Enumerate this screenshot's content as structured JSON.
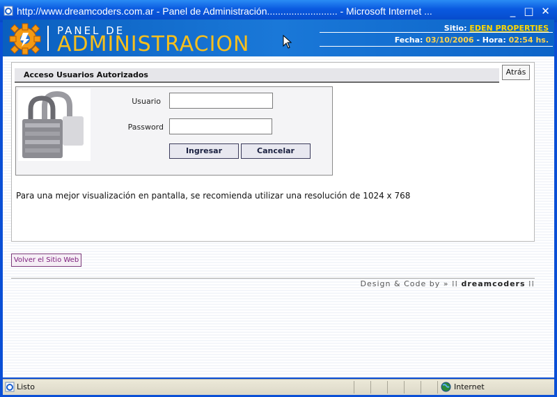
{
  "window": {
    "title": "http://www.dreamcoders.com.ar - Panel de Administración.......................... - Microsoft Internet ...",
    "minimize_symbol": "_",
    "maximize_symbol": "□",
    "close_symbol": "✕"
  },
  "header": {
    "logo_top": "PANEL DE",
    "logo_main": "ADMINISTRACION",
    "sitio_label": "Sitio:",
    "sitio_value": "EDEN PROPERTIES",
    "fecha_label": "Fecha:",
    "fecha_value": "03/10/2006",
    "hora_label": "- Hora:",
    "hora_value": "02:54 hs."
  },
  "login": {
    "title": "Acceso Usuarios Autorizados",
    "back_button": "Atrás",
    "usuario_label": "Usuario",
    "usuario_value": "",
    "password_label": "Password",
    "password_value": "",
    "ingresar_button": "Ingresar",
    "cancelar_button": "Cancelar",
    "note": "Para una mejor visualización en pantalla, se recomienda utilizar una resolución de 1024 x 768"
  },
  "footer": {
    "volver_link": "Volver el Sitio Web",
    "credit": "Design & Code by »",
    "brand": "dreamcoders"
  },
  "statusbar": {
    "status": "Listo",
    "zone": "Internet"
  },
  "colors": {
    "title_bar": "#0a5ae0",
    "header_blue": "#1a78d8",
    "logo_yellow": "#f7bf1c",
    "link_yellow": "#ffd700"
  }
}
